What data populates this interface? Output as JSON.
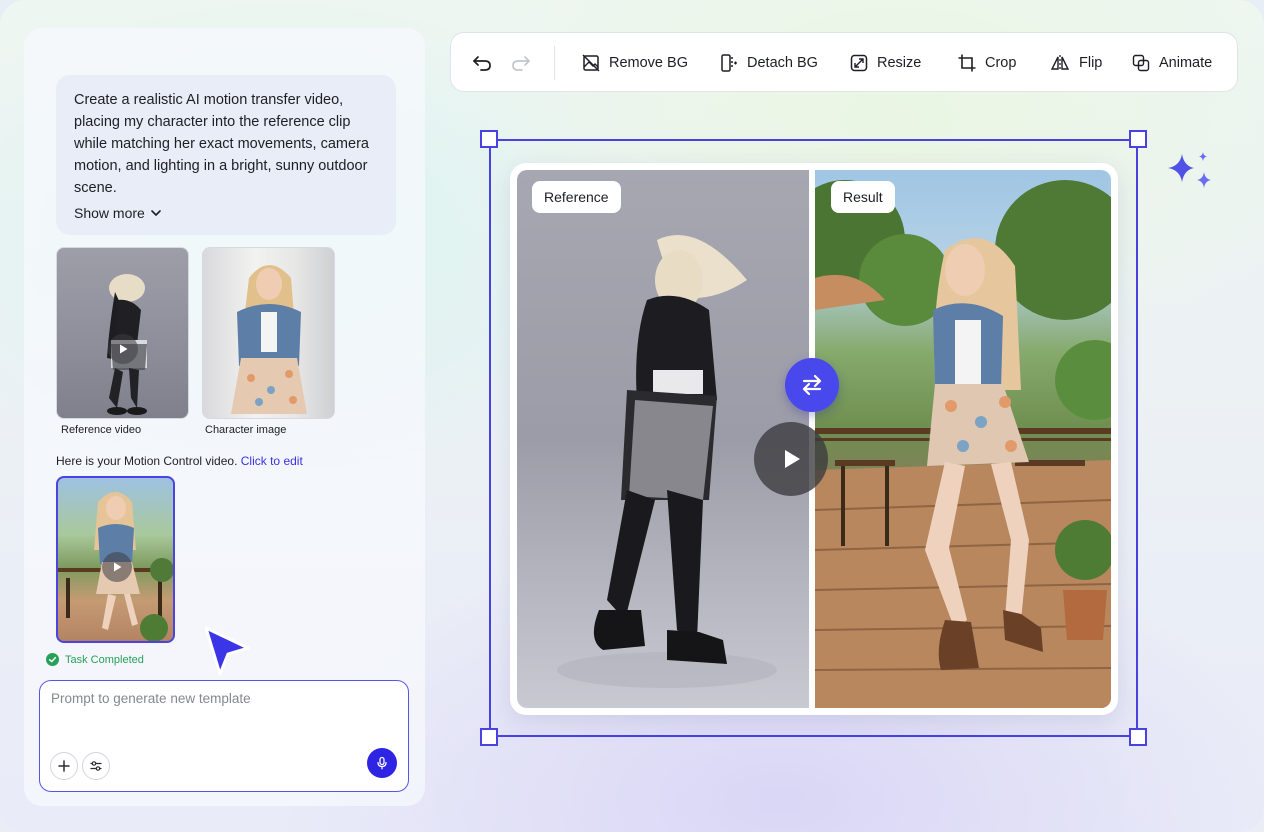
{
  "chat": {
    "prompt": "Create a realistic AI motion transfer video, placing my character into the reference clip while matching her exact movements, camera motion, and lighting in a bright, sunny outdoor scene.",
    "show_more_label": "Show more",
    "attachments": [
      {
        "label": "Reference video"
      },
      {
        "label": "Character image"
      }
    ],
    "result_message": "Here is your Motion Control video.",
    "result_link": "Click to edit",
    "status": "Task Completed",
    "input": {
      "placeholder": "Prompt to generate new template",
      "value": ""
    }
  },
  "toolbar": {
    "buttons": [
      {
        "label": "Remove BG",
        "icon": "remove-bg-icon"
      },
      {
        "label": "Detach BG",
        "icon": "detach-bg-icon"
      },
      {
        "label": "Resize",
        "icon": "resize-icon"
      },
      {
        "label": "Crop",
        "icon": "crop-icon"
      },
      {
        "label": "Flip",
        "icon": "flip-icon"
      },
      {
        "label": "Animate",
        "icon": "animate-icon"
      }
    ]
  },
  "canvas": {
    "left_tag": "Reference",
    "right_tag": "Result"
  },
  "colors": {
    "accent": "#4a42e0",
    "mic": "#2d24e4",
    "swap": "#4848ec",
    "success": "#27a05a",
    "link": "#3b30e6"
  }
}
